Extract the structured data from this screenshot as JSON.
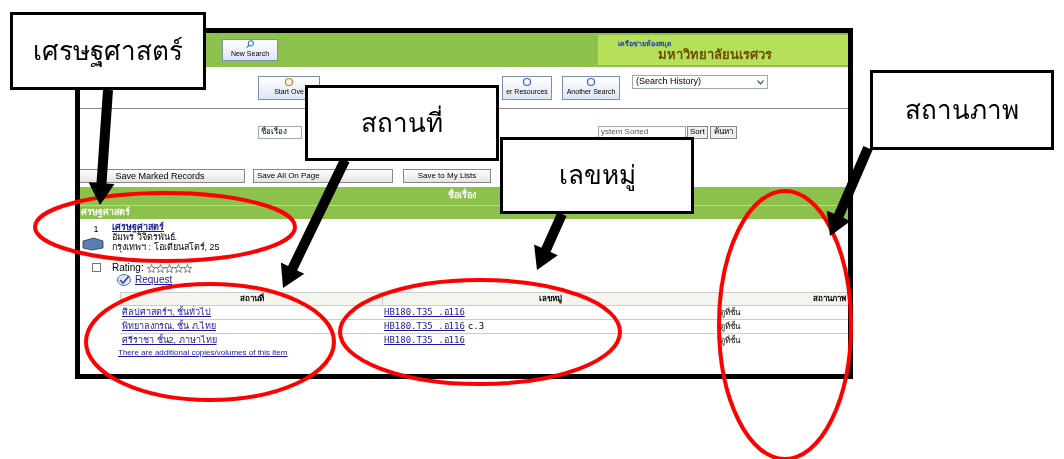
{
  "header": {
    "new_search": "New Search",
    "network": "เครือข่ายห้องสมุด",
    "university": "มหาวิทยาลัยนเรศวร"
  },
  "toolbar": {
    "buttons": [
      "Start Ove",
      "er Resources",
      "Another Search"
    ],
    "history_select": "(Search History)"
  },
  "search": {
    "field_select": "ชื่อเรื่อง",
    "sort_select": "ystem Sorted",
    "sort_button": "Sort",
    "search_button": "ค้นหา"
  },
  "save_buttons": [
    "Save Marked Records",
    "Save All On Page",
    "Save to My Lists"
  ],
  "results_bar": "ชื่อเรื่อง",
  "group_heading": "ศรษฐศาสตร์",
  "record": {
    "number": "1",
    "title": "เศรษฐศาสตร์",
    "author": "อัมพร วิจิตรพันธ์.",
    "imprint": "กรุงเทพฯ : โอเดียนสโตร์, 25",
    "checked": false,
    "rating_label": "Rating:",
    "stars": 0,
    "request": "Request"
  },
  "holdings": {
    "columns": [
      "สถานที่",
      "เลขหมู่",
      "สถานภาพ"
    ],
    "rows": [
      {
        "location": "ศิลปศาสตร์ฯ, ชั้นทั่วไป",
        "call_number": "HB180.T35 .อ116",
        "status": "ดูที่ชั้น"
      },
      {
        "location": "พิทยาลงกรณ, ชั้น ภ.ไทย",
        "call_number": "HB180.T35 .อ116",
        "copy": "c.3",
        "status": "ดูที่ชั้น"
      },
      {
        "location": "ศรีราชา ชั้น2, ภาษาไทย",
        "call_number": "HB180.T35 .อ116",
        "status": "ดูที่ชั้น"
      }
    ],
    "more_link": "There are additional copies/volumes of this item"
  },
  "callouts": [
    "เศรษฐศาสตร์",
    "สถานที่",
    "เลขหมู่",
    "สถานภาพ"
  ]
}
